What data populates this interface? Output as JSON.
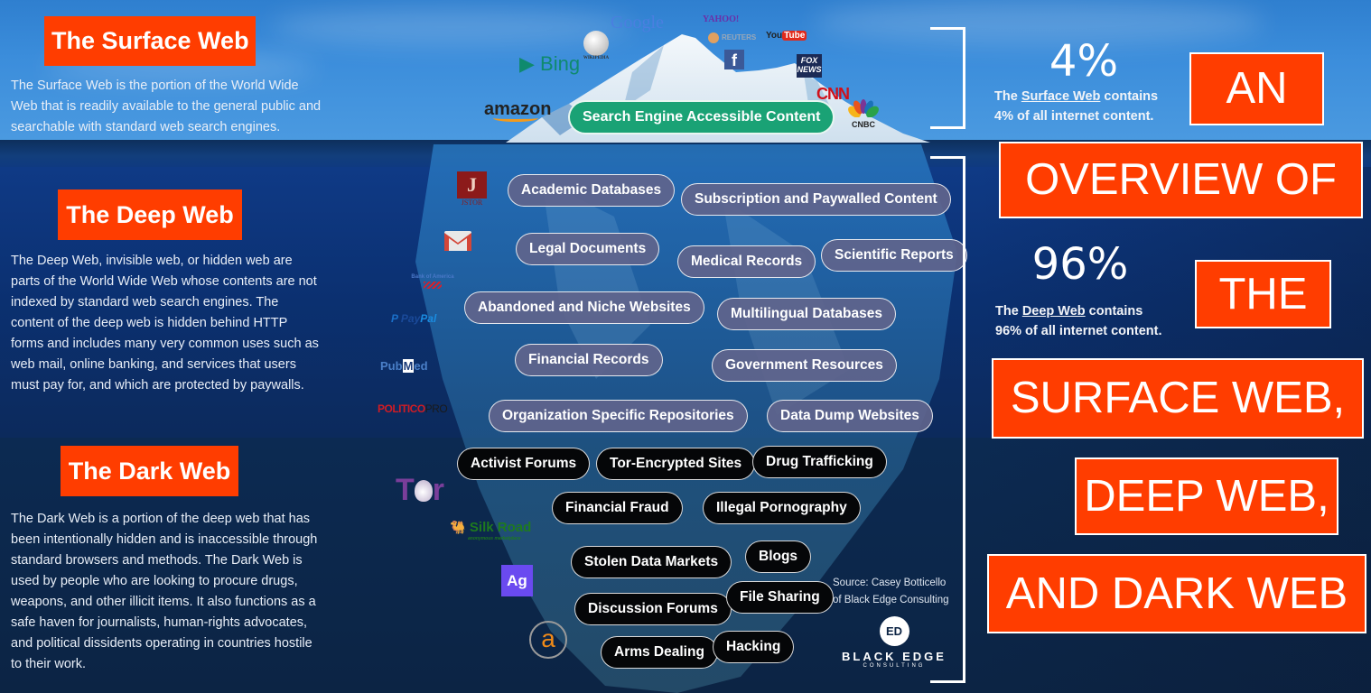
{
  "sections": {
    "surface": {
      "title": "The Surface Web",
      "description": "The Surface Web is the portion of the World Wide Web that is readily available to the general public and searchable with standard web search engines.",
      "pill": "Search Engine Accessible Content",
      "logos": {
        "google": "Google",
        "yahoo": "YAHOO!",
        "reuters": "REUTERS",
        "youtube_you": "You",
        "youtube_tube": "Tube",
        "wikipedia": "WIKIPEDIA",
        "bing": "Bing",
        "facebook": "f",
        "fox_line1": "FOX",
        "fox_line2": "NEWS",
        "amazon": "amazon",
        "cnn": "CNN",
        "cnbc": "CNBC"
      }
    },
    "deep": {
      "title": "The Deep Web",
      "description": "The Deep Web, invisible web, or hidden web are parts of the World Wide Web whose contents are not indexed by standard web search engines. The content of the deep web is hidden behind HTTP forms and includes many very common uses such as web mail, online banking, and services that users must pay for, and which are protected by paywalls.",
      "pills": [
        "Academic Databases",
        "Subscription and Paywalled Content",
        "Legal Documents",
        "Medical Records",
        "Scientific Reports",
        "Abandoned and Niche Websites",
        "Multilingual Databases",
        "Financial Records",
        "Government Resources",
        "Organization Specific Repositories",
        "Data Dump Websites"
      ],
      "logos": {
        "jstor": "JSTOR",
        "bank_of_america": "Bank of America",
        "paypal_pay": "Pay",
        "paypal_pal": "Pal",
        "pubmed_pub": "Pub",
        "pubmed_m": "M",
        "pubmed_ed": "ed",
        "politico": "POLITICO",
        "politico_pro": "PRO"
      }
    },
    "dark": {
      "title": "The Dark Web",
      "description": "The Dark Web is a portion of the deep web that has been intentionally hidden and is inaccessible through standard browsers and methods. The Dark Web is used by people who are looking to procure drugs, weapons, and other illicit items. It also functions as a safe haven for journalists, human-rights advocates, and political dissidents operating in countries hostile to their work.",
      "pills": [
        "Activist Forums",
        "Tor-Encrypted Sites",
        "Drug Trafficking",
        "Financial Fraud",
        "Illegal Pornography",
        "Stolen Data Markets",
        "Blogs",
        "Discussion Forums",
        "File Sharing",
        "Arms Dealing",
        "Hacking"
      ],
      "logos": {
        "tor_t": "T",
        "tor_r": "r",
        "silk_road": "Silk Road",
        "silk_road_sub": "anonymous marketplace",
        "agora": "Ag",
        "alphabay": "a"
      }
    }
  },
  "stats": {
    "surface": {
      "percent": "4%",
      "line1_prefix": "The ",
      "line1_link": "Surface Web",
      "line1_suffix": " contains",
      "line2": "4% of all internet content."
    },
    "deep": {
      "percent": "96%",
      "line1_prefix": "The ",
      "line1_link": "Deep Web",
      "line1_suffix": " contains",
      "line2": "96% of all internet content."
    }
  },
  "headline": [
    "AN",
    "OVERVIEW OF",
    "THE",
    "SURFACE WEB,",
    "DEEP WEB,",
    "AND DARK WEB"
  ],
  "source": {
    "line1": "Source: Casey Botticello",
    "line2": "of Black Edge Consulting",
    "brand": "ƎLACK EDGE",
    "brand_main": "BLACK EDGE",
    "brand_sub": "CONSULTING",
    "brand_mark": "ED"
  },
  "colors": {
    "accent_orange": "#ff3d00",
    "surface_pill": "#1aa275",
    "deep_pill": "#5f648c",
    "dark_pill": "#050608"
  }
}
